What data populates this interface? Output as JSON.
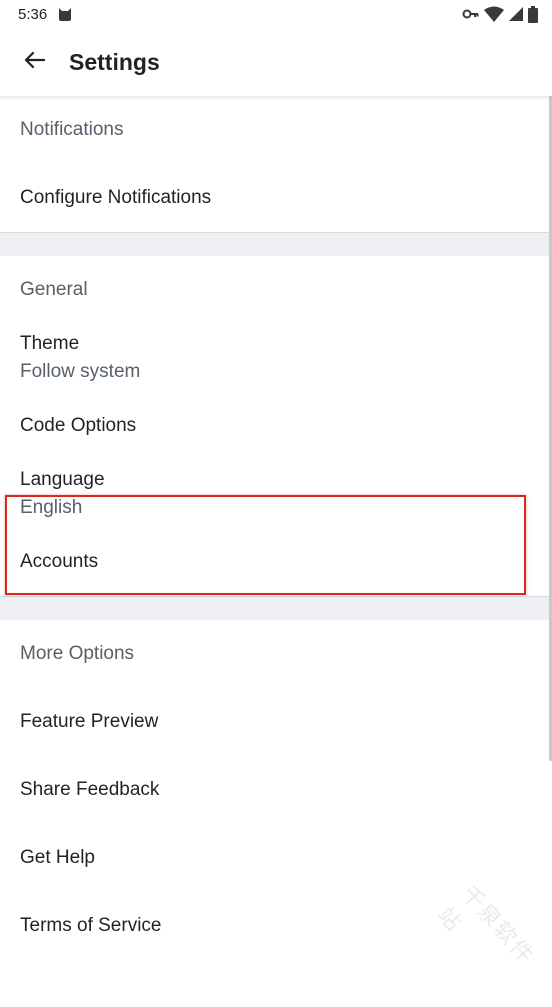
{
  "status_bar": {
    "time": "5:36"
  },
  "app_bar": {
    "title": "Settings"
  },
  "sections": {
    "notifications": {
      "header": "Notifications",
      "configure_label": "Configure Notifications"
    },
    "general": {
      "header": "General",
      "theme_label": "Theme",
      "theme_value": "Follow system",
      "code_options_label": "Code Options",
      "language_label": "Language",
      "language_value": "English",
      "accounts_label": "Accounts"
    },
    "more_options": {
      "header": "More Options",
      "feature_preview_label": "Feature Preview",
      "share_feedback_label": "Share Feedback",
      "get_help_label": "Get Help",
      "terms_label": "Terms of Service"
    }
  },
  "watermark": "千泉软件站",
  "colors": {
    "highlight": "#d9281f",
    "divider": "#eef0f3",
    "secondary_text": "#57606a",
    "primary_text": "#1f2328"
  },
  "icons": {
    "status_left": [
      "cat-icon"
    ],
    "status_right": [
      "vpn-key-icon",
      "wifi-icon",
      "signal-icon",
      "battery-icon"
    ],
    "app_bar": "back-arrow-icon"
  }
}
